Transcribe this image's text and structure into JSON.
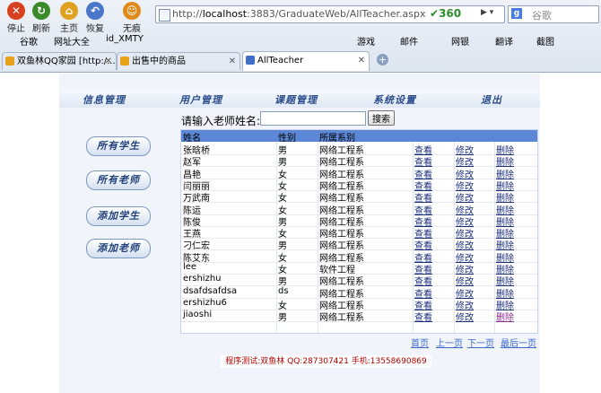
{
  "browser": {
    "nav": [
      {
        "label": "停止",
        "icon": "stop-icon",
        "color": "#d9401f"
      },
      {
        "label": "刷新",
        "icon": "refresh-icon",
        "color": "#3b8a2a"
      },
      {
        "label": "主页",
        "icon": "home-icon",
        "color": "#e0a020"
      },
      {
        "label": "恢复",
        "icon": "restore-icon",
        "color": "#4a77c9"
      },
      {
        "label": "无痕",
        "icon": "incognito-icon",
        "color": "#e08a1a"
      }
    ],
    "address": {
      "prefix": "http://",
      "host": "localhost",
      "path": ":3883/GraduateWeb/AllTeacher.aspx",
      "engine": "360"
    },
    "search_placeholder": "谷歌",
    "bookmarks": [
      "谷歌",
      "网址大全",
      "id_XMTY",
      "游戏",
      "邮件",
      "网银",
      "翻译",
      "截图"
    ],
    "tabs": [
      {
        "label": "双鱼林QQ家园 [http:/...",
        "active": false
      },
      {
        "label": "出售中的商品",
        "active": false
      },
      {
        "label": "AllTeacher",
        "active": true
      }
    ]
  },
  "page": {
    "top_nav": [
      "信息管理",
      "用户管理",
      "课题管理",
      "系统设置",
      "退出"
    ],
    "side_buttons": [
      "所有学生",
      "所有老师",
      "添加学生",
      "添加老师"
    ],
    "search": {
      "label": "请输入老师姓名:",
      "value": "",
      "button": "搜索"
    },
    "table": {
      "headers": [
        "姓名",
        "性别",
        "所属系别",
        "",
        "",
        ""
      ],
      "action_labels": {
        "view": "查看",
        "edit": "修改",
        "delete": "删除"
      },
      "rows": [
        {
          "name": "张晗桥",
          "sex": "男",
          "dept": "网络工程系"
        },
        {
          "name": "赵军",
          "sex": "男",
          "dept": "网络工程系"
        },
        {
          "name": "昌艳",
          "sex": "女",
          "dept": "网络工程系"
        },
        {
          "name": "闫丽丽",
          "sex": "女",
          "dept": "网络工程系"
        },
        {
          "name": "万武南",
          "sex": "女",
          "dept": "网络工程系"
        },
        {
          "name": "陈运",
          "sex": "女",
          "dept": "网络工程系"
        },
        {
          "name": "陈俊",
          "sex": "男",
          "dept": "网络工程系"
        },
        {
          "name": "王燕",
          "sex": "女",
          "dept": "网络工程系"
        },
        {
          "name": "刁仁宏",
          "sex": "男",
          "dept": "网络工程系"
        },
        {
          "name": "陈艾东",
          "sex": "女",
          "dept": "网络工程系"
        },
        {
          "name": "lee",
          "sex": "女",
          "dept": "软件工程"
        },
        {
          "name": "ershizhu",
          "sex": "男",
          "dept": "网络工程系"
        },
        {
          "name": "dsafdsafdsa",
          "sex": "ds",
          "dept": "网络工程系"
        },
        {
          "name": "ershizhu6",
          "sex": "女",
          "dept": "网络工程系"
        },
        {
          "name": "jiaoshi",
          "sex": "男",
          "dept": "网络工程系"
        }
      ]
    },
    "pager": [
      "首页",
      "上一页",
      "下一页",
      "最后一页"
    ],
    "footer": "程序测试:双鱼林  QQ:287307421  手机:13558690869"
  }
}
